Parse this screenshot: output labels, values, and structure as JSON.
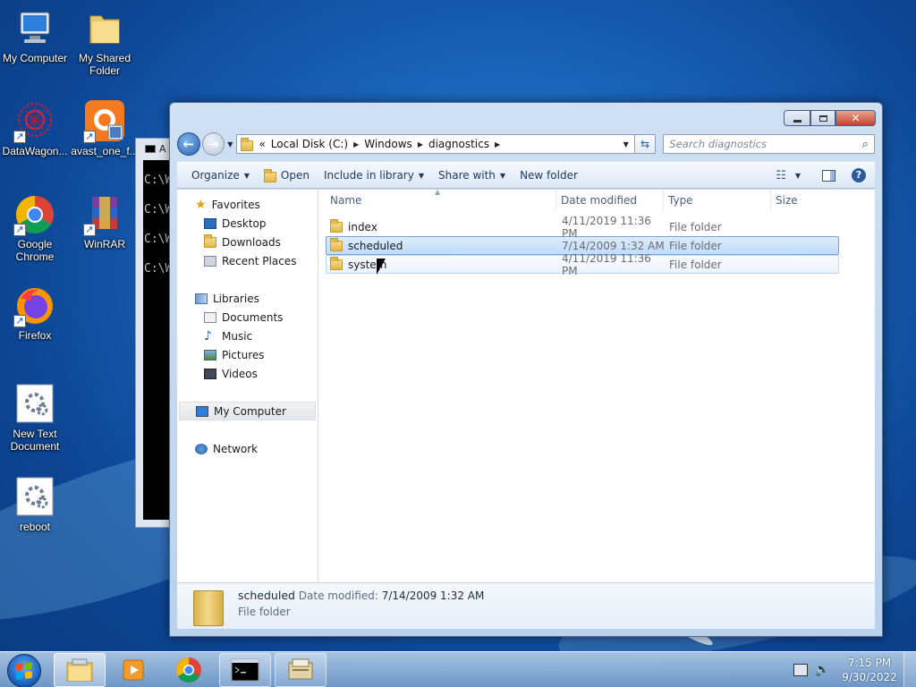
{
  "desktop": {
    "icons": [
      {
        "label": "My Computer",
        "icon": "computer-icon"
      },
      {
        "label": "My Shared Folder",
        "icon": "folder-icon"
      },
      {
        "label": "DataWagon...",
        "icon": "datawagon-icon"
      },
      {
        "label": "avast_one_f...",
        "icon": "avast-icon"
      },
      {
        "label": "Google Chrome",
        "icon": "chrome-icon"
      },
      {
        "label": "WinRAR",
        "icon": "winrar-icon"
      },
      {
        "label": "Firefox",
        "icon": "firefox-icon"
      },
      {
        "label": "New Text Document",
        "icon": "text-document-icon"
      },
      {
        "label": "reboot",
        "icon": "script-icon"
      }
    ]
  },
  "console": {
    "title": "A",
    "lines": [
      "C:\\W",
      "C:\\W",
      "C:\\W",
      "C:\\W"
    ]
  },
  "explorer": {
    "address": {
      "prefix": "«",
      "crumbs": [
        "Local Disk (C:)",
        "Windows",
        "diagnostics"
      ]
    },
    "search_placeholder": "Search diagnostics",
    "toolbar": {
      "organize": "Organize",
      "open": "Open",
      "include": "Include in library",
      "share": "Share with",
      "new_folder": "New folder"
    },
    "nav": {
      "favorites": "Favorites",
      "desktop": "Desktop",
      "downloads": "Downloads",
      "recent": "Recent Places",
      "libraries": "Libraries",
      "documents": "Documents",
      "music": "Music",
      "pictures": "Pictures",
      "videos": "Videos",
      "computer": "My Computer",
      "network": "Network"
    },
    "columns": {
      "name": "Name",
      "date": "Date modified",
      "type": "Type",
      "size": "Size"
    },
    "files": [
      {
        "name": "index",
        "date": "4/11/2019 11:36 PM",
        "type": "File folder"
      },
      {
        "name": "scheduled",
        "date": "7/14/2009 1:32 AM",
        "type": "File folder"
      },
      {
        "name": "system",
        "date": "4/11/2019 11:36 PM",
        "type": "File folder"
      }
    ],
    "details": {
      "name": "scheduled",
      "date_label": "Date modified:",
      "date_value": "7/14/2009 1:32 AM",
      "type": "File folder"
    }
  },
  "taskbar": {
    "time": "7:15 PM",
    "date": "9/30/2022"
  },
  "colors": {
    "accent": "#1a63b8",
    "selection": "#c1dcfc",
    "close": "#c6412a"
  }
}
